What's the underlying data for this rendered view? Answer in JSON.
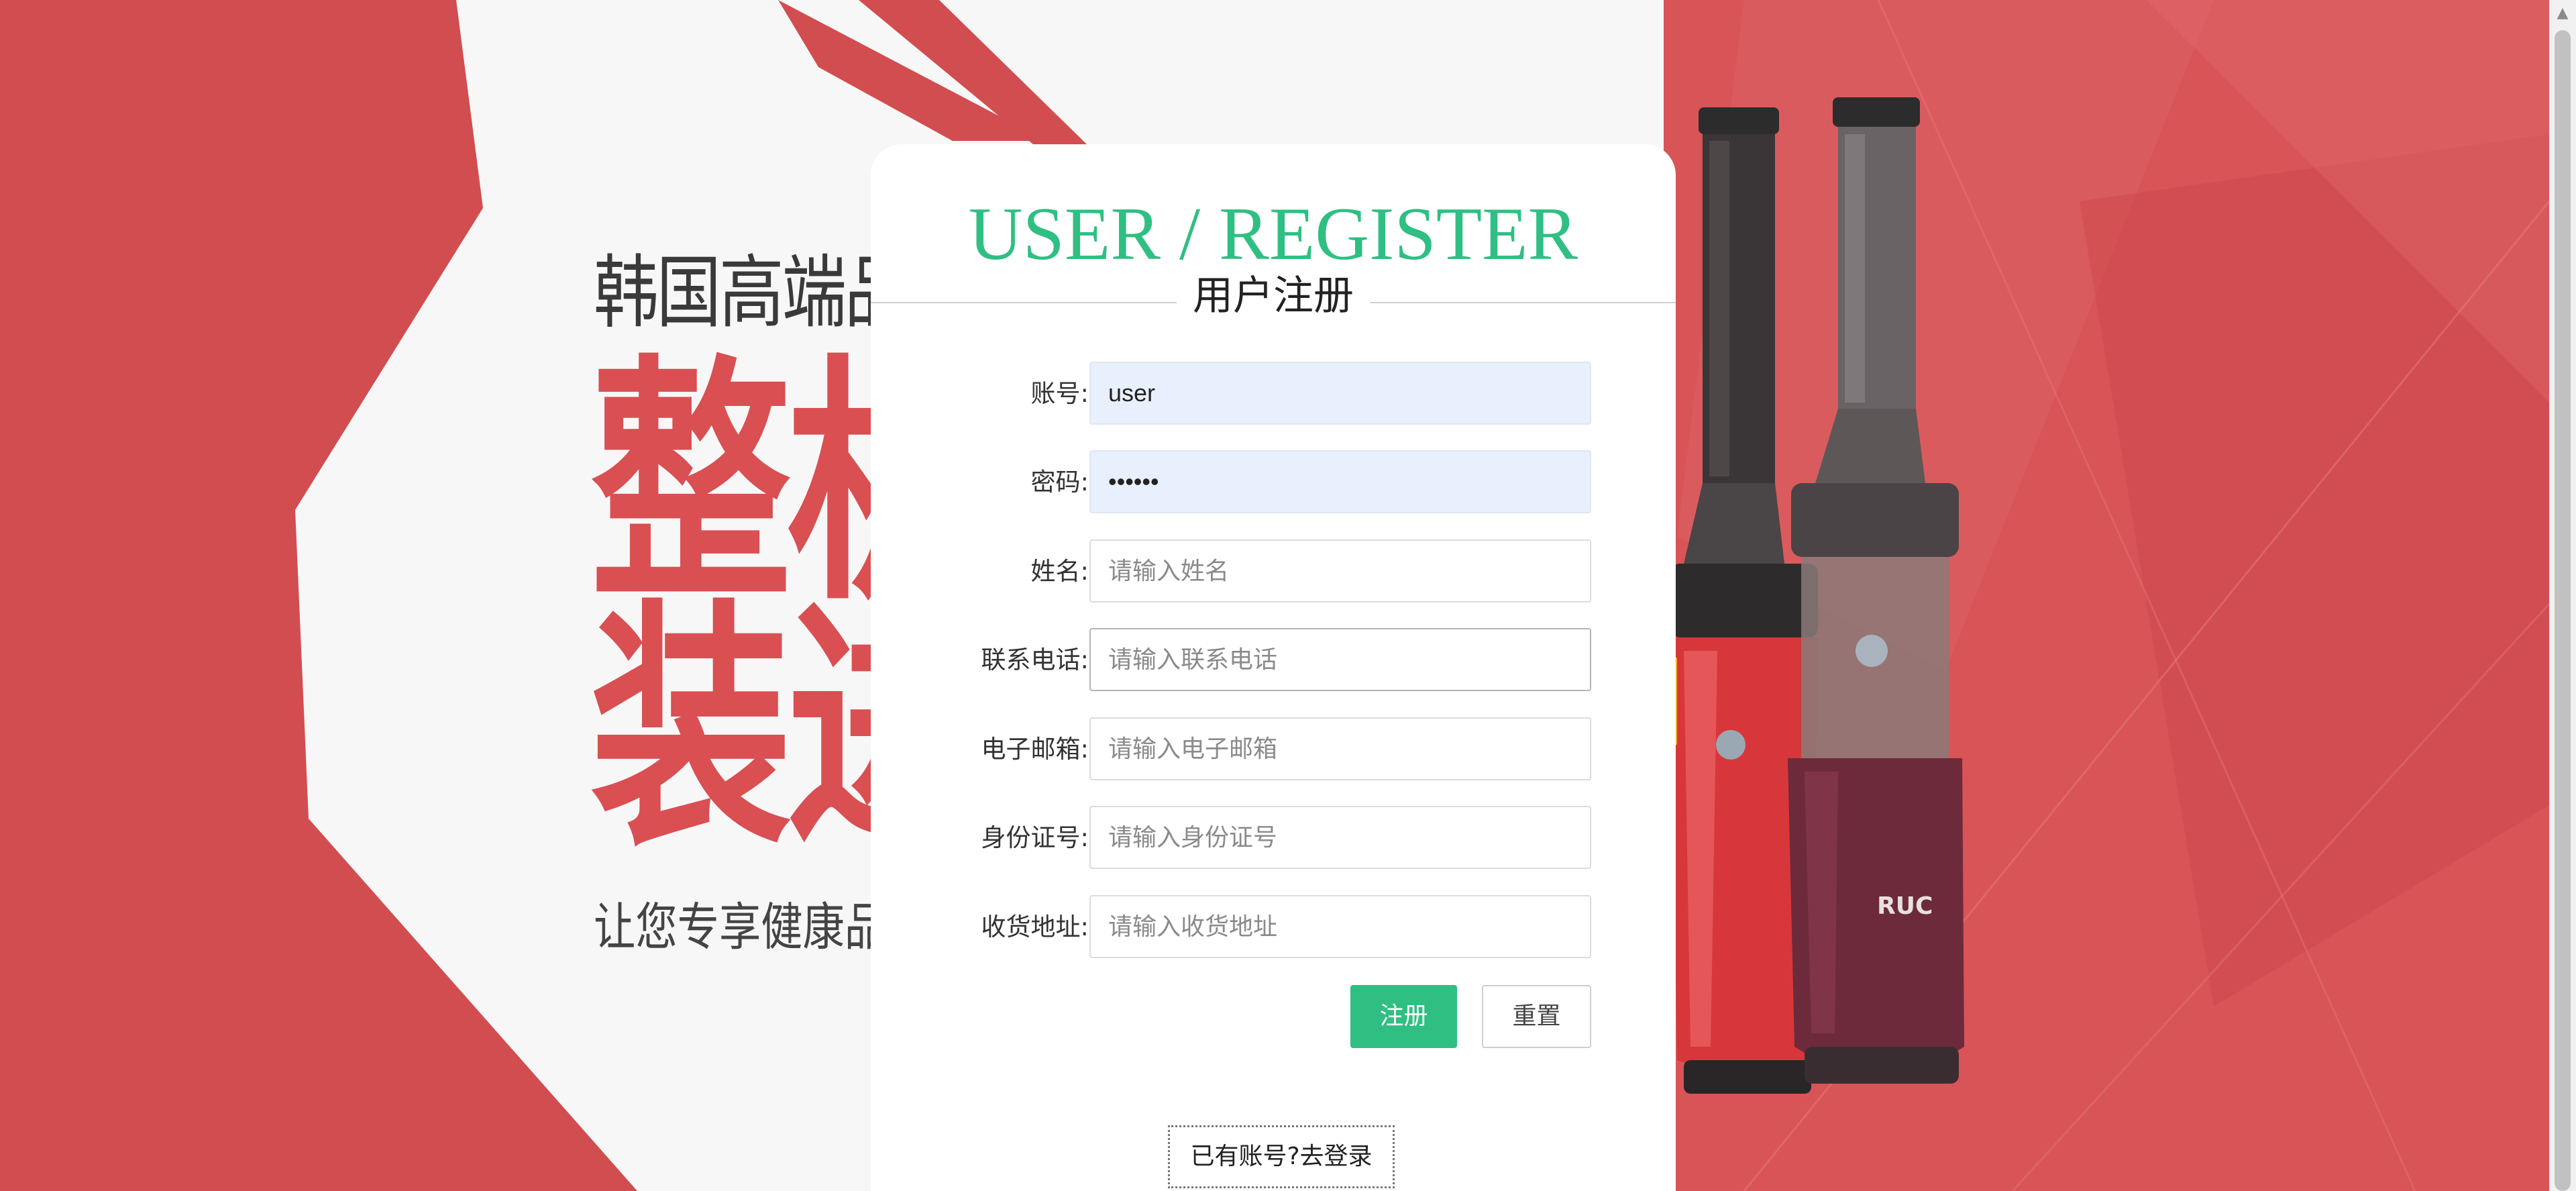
{
  "page": {
    "accent_color": "#2fbf82",
    "background_color": "#d24d50"
  },
  "banner": {
    "brand_line": "韩国高端品牌",
    "headline_line1": "整机原",
    "headline_line2": "装进口",
    "slogan": "让您专享健康品质生活",
    "product_label": "RUC"
  },
  "register": {
    "title": "USER / REGISTER",
    "subtitle": "用户注册",
    "fields": [
      {
        "label": "账号:",
        "value": "user",
        "placeholder": "",
        "type": "text"
      },
      {
        "label": "密码:",
        "value": "••••••",
        "placeholder": "",
        "type": "password"
      },
      {
        "label": "姓名:",
        "value": "",
        "placeholder": "请输入姓名",
        "type": "text"
      },
      {
        "label": "联系电话:",
        "value": "",
        "placeholder": "请输入联系电话",
        "type": "text"
      },
      {
        "label": "电子邮箱:",
        "value": "",
        "placeholder": "请输入电子邮箱",
        "type": "text"
      },
      {
        "label": "身份证号:",
        "value": "",
        "placeholder": "请输入身份证号",
        "type": "text"
      },
      {
        "label": "收货地址:",
        "value": "",
        "placeholder": "请输入收货地址",
        "type": "text"
      }
    ],
    "register_button": "注册",
    "reset_button": "重置",
    "login_link": "已有账号?去登录"
  },
  "scrollbar": {
    "up_icon": "chevron-up-icon"
  }
}
